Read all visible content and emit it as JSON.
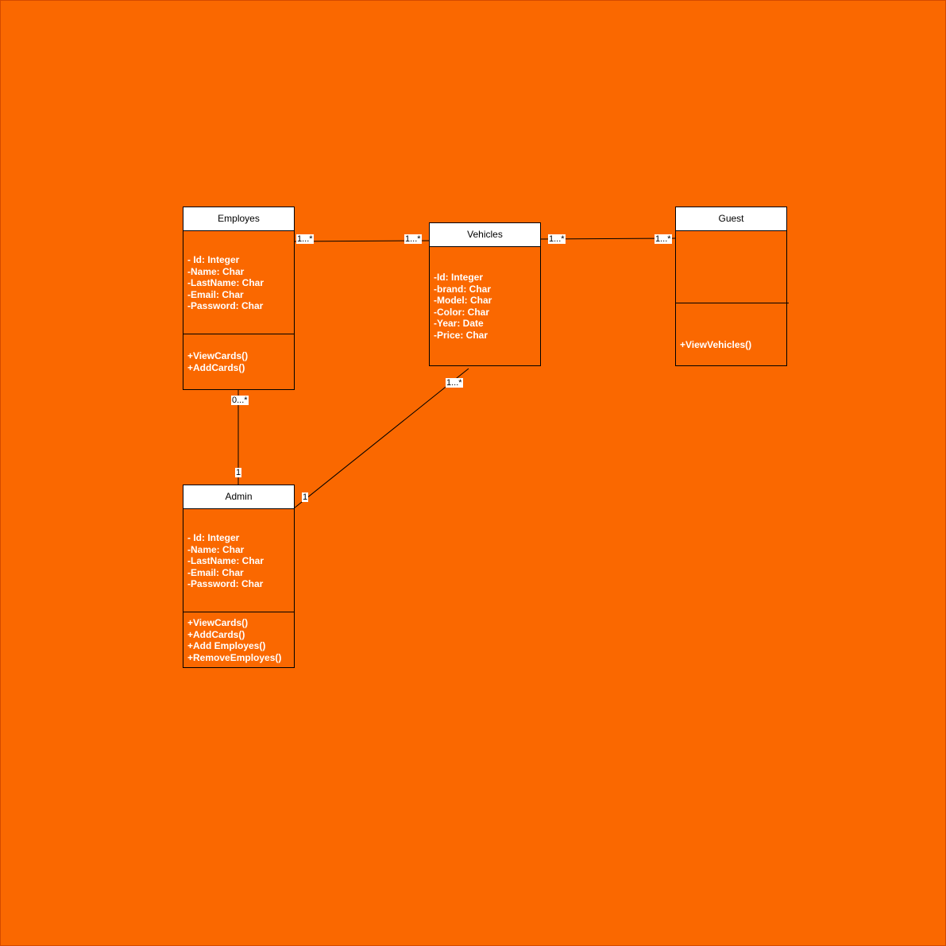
{
  "colors": {
    "background": "#fa6800",
    "header_fill": "#ffffff",
    "border": "#000000",
    "member_text": "#ffffff"
  },
  "classes": {
    "employes": {
      "name": "Employes",
      "attributes": [
        "- Id: Integer",
        "-Name: Char",
        "-LastName: Char",
        "-Email: Char",
        "-Password: Char"
      ],
      "methods": [
        "+ViewCards()",
        "+AddCards()"
      ]
    },
    "vehicles": {
      "name": "Vehicles",
      "attributes": [
        "-Id: Integer",
        "-brand: Char",
        "-Model: Char",
        "-Color: Char",
        "-Year: Date",
        "-Price: Char"
      ],
      "methods": []
    },
    "guest": {
      "name": "Guest",
      "attributes": [],
      "methods": [
        "+ViewVehicles()"
      ]
    },
    "admin": {
      "name": "Admin",
      "attributes": [
        "- Id: Integer",
        "-Name: Char",
        "-LastName: Char",
        "-Email: Char",
        "-Password: Char"
      ],
      "methods": [
        "+ViewCards()",
        "+AddCards()",
        "+Add Employes()",
        "+RemoveEmployes()"
      ]
    }
  },
  "associations": {
    "employes_vehicles": {
      "source_mult": "1...*",
      "target_mult": "1...*"
    },
    "vehicles_guest": {
      "source_mult": "1...*",
      "target_mult": "1...*"
    },
    "employes_admin": {
      "source_mult": "0...*",
      "target_mult": "1"
    },
    "admin_vehicles": {
      "source_mult": "1",
      "target_mult": "1...*"
    }
  }
}
